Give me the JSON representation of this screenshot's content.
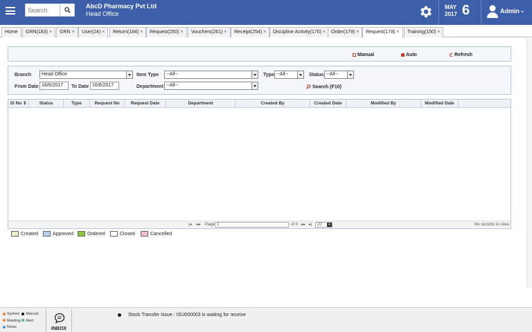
{
  "header": {
    "search_placeholder": "Search",
    "company_name": "AbcD Pharmacy Pvt Ltd",
    "branch_name": "Head Office",
    "date_month": "MAY",
    "date_year": "2017",
    "date_day": "6",
    "user_name": "Admin",
    "brand_color": "#3d5ea8"
  },
  "tabs": [
    {
      "label": "Home",
      "closable": false
    },
    {
      "label": "GRN(183)",
      "closable": true
    },
    {
      "label": "GRN",
      "closable": true
    },
    {
      "label": "User(24)",
      "closable": true
    },
    {
      "label": "Return(184)",
      "closable": true
    },
    {
      "label": "Request(250)",
      "closable": true
    },
    {
      "label": "Vouchers(261)",
      "closable": true
    },
    {
      "label": "Receipt(254)",
      "closable": true
    },
    {
      "label": "Discipline Activity(170)",
      "closable": true
    },
    {
      "label": "Order(179)",
      "closable": true
    },
    {
      "label": "Request(178)",
      "closable": true,
      "active": true
    },
    {
      "label": "Training(150)",
      "closable": true
    }
  ],
  "actions": {
    "manual": "Manual",
    "auto": "Auto",
    "refresh": "Refresh"
  },
  "filters": {
    "branch_label": "Branch",
    "branch_value": "Head Office",
    "item_type_label": "Item Type",
    "item_type_value": "--All--",
    "type_label": "Type",
    "type_value": "--All--",
    "status_label": "Status",
    "status_value": "--All--",
    "from_date_label": "From Date",
    "from_date_value": "16/6/2017",
    "to_date_label": "To Date",
    "to_date_value": "16/6/2017",
    "department_label": "Department",
    "department_value": "--All--",
    "search_label": "Search (F10)"
  },
  "grid": {
    "columns": [
      "Sl No",
      "Status",
      "Type",
      "Request No",
      "Request Date",
      "Department",
      "Created By",
      "Created Date",
      "Modified By",
      "Modified Date"
    ],
    "rows": [],
    "pager": {
      "page_label": "Page",
      "page_value": "1",
      "of_label": "of 0",
      "page_size": "20",
      "empty_text": "No records to view"
    }
  },
  "legend": [
    {
      "label": "Created",
      "color": "#e6f5c4"
    },
    {
      "label": "Approved",
      "color": "#b5d3ee"
    },
    {
      "label": "Ordered",
      "color": "#8cc63e"
    },
    {
      "label": "Closed",
      "color": "#ffffff"
    },
    {
      "label": "Cancelled",
      "color": "#f4bfcb"
    }
  ],
  "footer": {
    "notif_types": [
      {
        "label": "System",
        "color": "#e8833a"
      },
      {
        "label": "Manual",
        "color": "#111111"
      },
      {
        "label": "Meeting",
        "color": "#e8833a"
      },
      {
        "label": "Alert",
        "color": "#5cb85c"
      },
      {
        "label": "News",
        "color": "#3d8fd6"
      }
    ],
    "inbox_label": "INBOX",
    "ticker_text": "Stock Transfer Issue : ISU000003 is waiting for receive"
  }
}
